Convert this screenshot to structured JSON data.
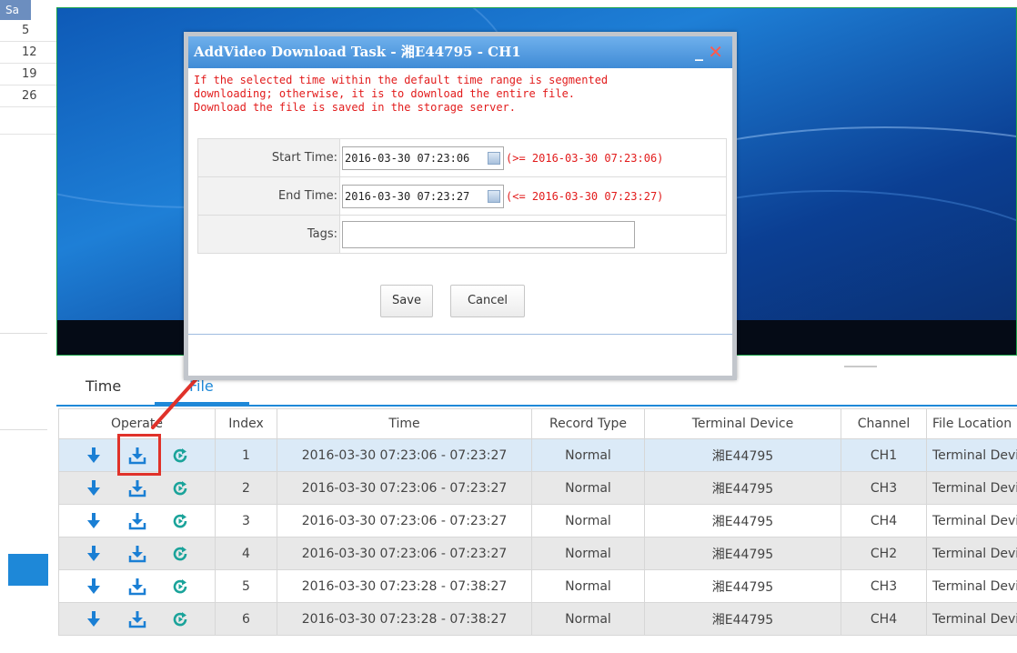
{
  "calendar": {
    "header": "Sa",
    "days": [
      "5",
      "12",
      "19",
      "26"
    ]
  },
  "tabs": {
    "time": "Time",
    "file": "File"
  },
  "table": {
    "headers": [
      "Operate",
      "Index",
      "Time",
      "Record Type",
      "Terminal Device",
      "Channel",
      "File Location"
    ],
    "rows": [
      {
        "index": "1",
        "time": "2016-03-30 07:23:06 - 07:23:27",
        "record_type": "Normal",
        "device": "湘E44795",
        "channel": "CH1",
        "location": "Terminal Device"
      },
      {
        "index": "2",
        "time": "2016-03-30 07:23:06 - 07:23:27",
        "record_type": "Normal",
        "device": "湘E44795",
        "channel": "CH3",
        "location": "Terminal Device"
      },
      {
        "index": "3",
        "time": "2016-03-30 07:23:06 - 07:23:27",
        "record_type": "Normal",
        "device": "湘E44795",
        "channel": "CH4",
        "location": "Terminal Device"
      },
      {
        "index": "4",
        "time": "2016-03-30 07:23:06 - 07:23:27",
        "record_type": "Normal",
        "device": "湘E44795",
        "channel": "CH2",
        "location": "Terminal Device"
      },
      {
        "index": "5",
        "time": "2016-03-30 07:23:28 - 07:38:27",
        "record_type": "Normal",
        "device": "湘E44795",
        "channel": "CH3",
        "location": "Terminal Device"
      },
      {
        "index": "6",
        "time": "2016-03-30 07:23:28 - 07:38:27",
        "record_type": "Normal",
        "device": "湘E44795",
        "channel": "CH4",
        "location": "Terminal Device"
      }
    ]
  },
  "dialog": {
    "title": "AddVideo Download Task - 湘E44795 - CH1",
    "minimize": "_",
    "close": "✕",
    "notice_1": "If the selected time within the default time range is segmented",
    "notice_2": "downloading; otherwise, it is to download the entire file.",
    "notice_3": "Download the file is saved in the storage server.",
    "start_label": "Start Time:",
    "start_value": "2016-03-30 07:23:06",
    "start_hint": "(>= 2016-03-30 07:23:06)",
    "end_label": "End Time:",
    "end_value": "2016-03-30 07:23:27",
    "end_hint": "(<= 2016-03-30 07:23:27)",
    "tags_label": "Tags:",
    "tags_value": "",
    "save": "Save",
    "cancel": "Cancel"
  },
  "colors": {
    "accent": "#1e88d8",
    "download_icon": "#1a7fd4",
    "playback_icon": "#1aa39a",
    "notice_text": "#e21b1b",
    "highlight": "#e0322a",
    "selected_row": "#dbeaf7"
  },
  "icons": {
    "row_operations": [
      "arrow-down-icon",
      "download-tray-icon",
      "playback-icon"
    ]
  }
}
